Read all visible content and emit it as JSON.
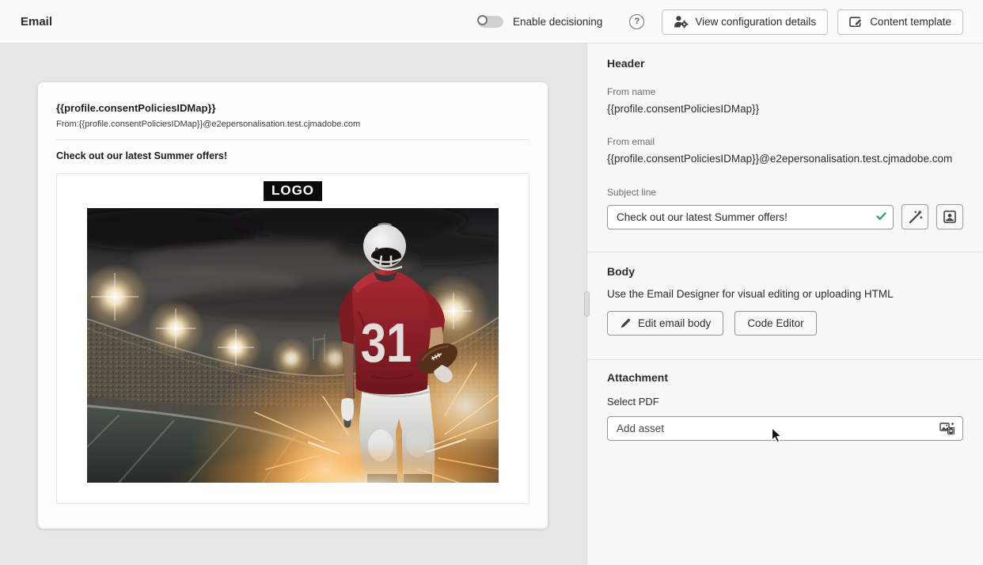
{
  "topbar": {
    "title": "Email",
    "decisioning_label": "Enable decisioning",
    "help_symbol": "?",
    "view_config_label": "View configuration details",
    "content_template_label": "Content template"
  },
  "preview": {
    "from_name": "{{profile.consentPoliciesIDMap}}",
    "from_line": "From:{{profile.consentPoliciesIDMap}}@e2epersonalisation.test.cjmadobe.com",
    "subject": "Check out our latest Summer offers!",
    "logo_text": "LOGO",
    "jersey_number": "31"
  },
  "panel": {
    "header": {
      "title": "Header",
      "from_name_label": "From name",
      "from_name_value": "{{profile.consentPoliciesIDMap}}",
      "from_email_label": "From email",
      "from_email_value": "{{profile.consentPoliciesIDMap}}@e2epersonalisation.test.cjmadobe.com",
      "subject_label": "Subject line",
      "subject_value": "Check out our latest Summer offers!"
    },
    "body": {
      "title": "Body",
      "description": "Use the Email Designer for visual editing or uploading HTML",
      "edit_button_label": "Edit email body",
      "code_button_label": "Code Editor"
    },
    "attachment": {
      "title": "Attachment",
      "select_pdf_label": "Select PDF",
      "add_asset_label": "Add asset"
    }
  },
  "colors": {
    "valid_green": "#2e9b72",
    "panel_bg": "#f7f7f6",
    "canvas_bg": "#e7e7e7"
  }
}
